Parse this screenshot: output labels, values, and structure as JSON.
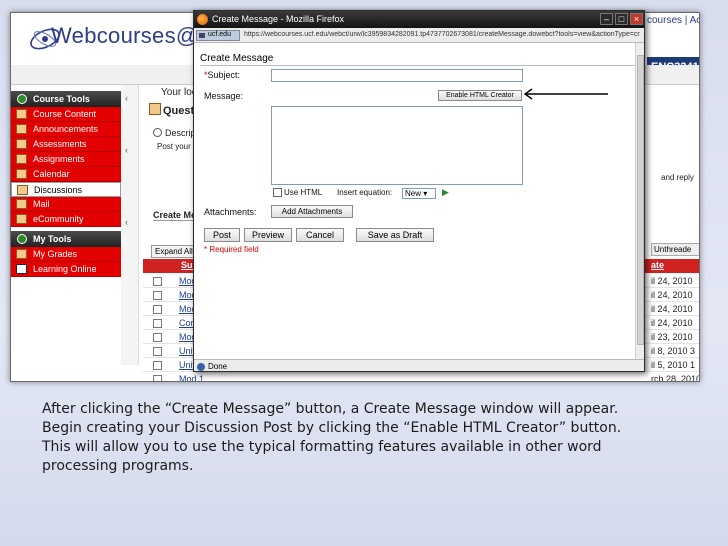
{
  "lms": {
    "logo_text": "Webcourses@U",
    "top_links": "courses | Ac",
    "course_code": "ENC3241",
    "partial_your_loc": "Your loc",
    "partial_question": "Questi",
    "partial_description": "Descripti",
    "partial_post_your": "Post your qu",
    "partial_create_me": "Create Me",
    "partial_and_reply": "and reply",
    "expand_all": "Expand All",
    "unthreaded": "Unthreade",
    "grid_subject": "Subject",
    "grid_date": "ate",
    "sidebar": {
      "course_tools": "Course Tools",
      "items": [
        {
          "label": "Course Content"
        },
        {
          "label": "Announcements"
        },
        {
          "label": "Assessments"
        },
        {
          "label": "Assignments"
        },
        {
          "label": "Calendar"
        },
        {
          "label": "Discussions"
        },
        {
          "label": "Mail"
        },
        {
          "label": "eCommunity"
        }
      ],
      "my_tools": "My Tools",
      "my_items": [
        {
          "label": "My Grades"
        },
        {
          "label": "Learning Online"
        }
      ]
    },
    "rows": [
      {
        "label": "Modu",
        "date": "il 24, 2010"
      },
      {
        "label": "Modu",
        "date": "il 24, 2010"
      },
      {
        "label": "Modu",
        "date": "il 24, 2010"
      },
      {
        "label": "Core",
        "date": "il 24, 2010"
      },
      {
        "label": "Modu",
        "date": "il 23, 2010"
      },
      {
        "label": "Unit3",
        "date": "il 8, 2010 3"
      },
      {
        "label": "Unit1",
        "date": "il 5, 2010 1"
      },
      {
        "label": "Mod 1",
        "date": "rch 28, 2010"
      },
      {
        "label": "Mod 1",
        "date": "rch 28, 2010"
      }
    ]
  },
  "popup": {
    "title": "Create Message - Mozilla Firefox",
    "site_id": "ucf.edu",
    "url": "https://webcourses.ucf.edu/webct/urw/lc3959834282091.tp4737702673081/createMessage.dowebct?tools=view&actionType=cr",
    "form_title": "Create Message",
    "subject_label": "Subject:",
    "subject_star": "*",
    "message_label": "Message:",
    "enable_html_creator": "Enable HTML Creator",
    "use_html": "Use HTML",
    "insert_equation": "Insert equation:",
    "equation_option": "New",
    "attachments_label": "Attachments:",
    "add_attachments": "Add Attachments",
    "post": "Post",
    "preview": "Preview",
    "cancel": "Cancel",
    "save_as_draft": "Save as Draft",
    "required_note": "Required field",
    "required_star": "*",
    "status": "Done"
  },
  "caption": {
    "line1": "After clicking the “Create Message” button, a Create Message window will appear.",
    "line2": "Begin creating your Discussion Post by clicking the “Enable HTML Creator” button.",
    "line3": "This will allow you to use the typical formatting features available in other word",
    "line4": "processing programs."
  },
  "colors": {
    "sidebar_red": "#e30000",
    "course_code_bg": "#1d3a78",
    "grid_header_red": "#d12222",
    "logo_blue": "#2d3d8c"
  }
}
